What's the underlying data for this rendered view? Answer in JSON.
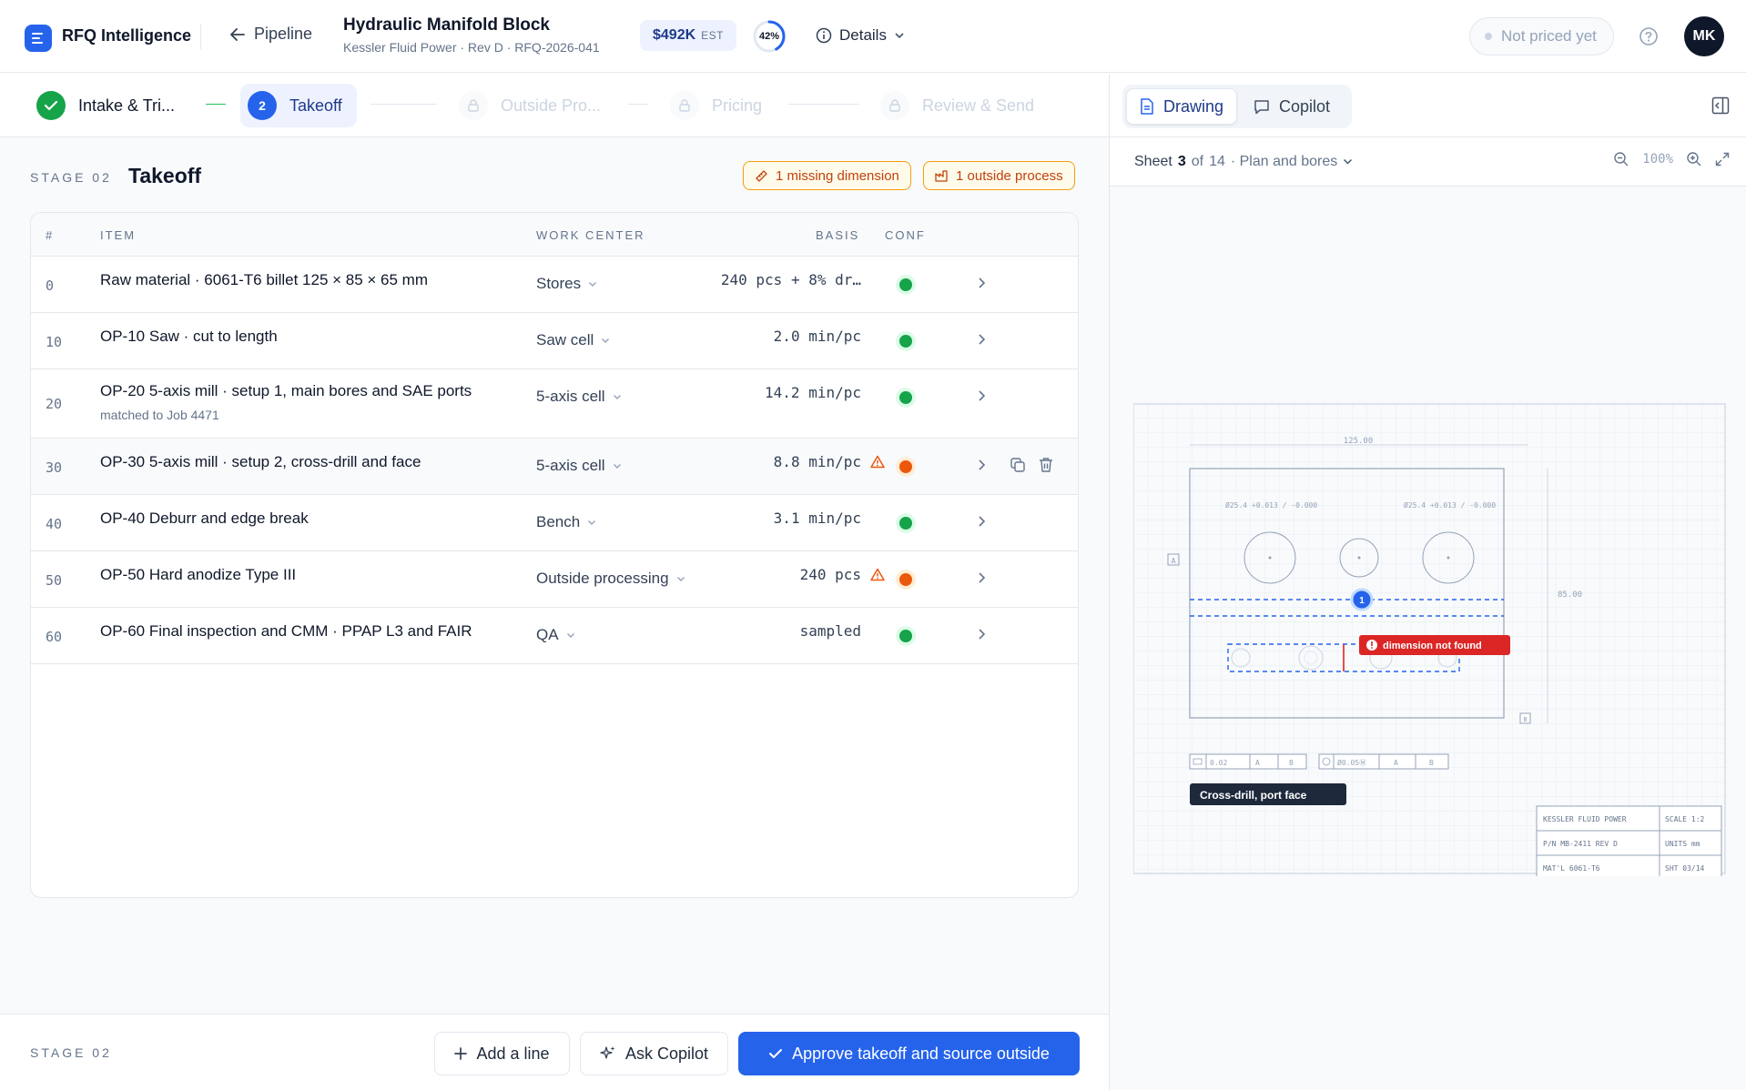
{
  "app": {
    "title": "RFQ Intelligence",
    "back_label": "Pipeline"
  },
  "doc": {
    "title": "Hydraulic Manifold Block",
    "subtitle": "Kessler Fluid Power · Rev D · RFQ-2026-041",
    "estimate": "$492K",
    "estimate_unit": "EST",
    "progress_label": "42%",
    "progress_value": 0.42,
    "details_label": "Details"
  },
  "status": {
    "not_priced": "Not priced yet"
  },
  "user": {
    "initials": "MK"
  },
  "stepper": {
    "steps": [
      {
        "label": "Intake & Tri...",
        "state": "done"
      },
      {
        "label": "Takeoff",
        "number": "2",
        "state": "active"
      },
      {
        "label": "Outside Pro...",
        "state": "locked"
      },
      {
        "label": "Pricing",
        "state": "locked"
      },
      {
        "label": "Review & Send",
        "state": "locked"
      }
    ]
  },
  "stage": {
    "label": "STAGE 02",
    "title": "Takeoff",
    "chips": {
      "missing": "1 missing dimension",
      "outside": "1 outside process"
    }
  },
  "table": {
    "columns": {
      "num": "#",
      "item": "ITEM",
      "work_center": "WORK CENTER",
      "basis": "BASIS",
      "conf": "CONF"
    },
    "rows": [
      {
        "num": "0",
        "item": "Raw material · 6061-T6 billet 125 × 85 × 65 mm",
        "sub": "",
        "work_center": "Stores",
        "basis": "240 pcs + 8% dr…",
        "conf": "green",
        "warn": false
      },
      {
        "num": "10",
        "item": "OP-10 Saw · cut to length",
        "sub": "",
        "work_center": "Saw cell",
        "basis": "2.0 min/pc",
        "conf": "green",
        "warn": false
      },
      {
        "num": "20",
        "item": "OP-20 5-axis mill · setup 1, main bores and SAE ports",
        "sub": "matched to Job 4471",
        "work_center": "5-axis cell",
        "basis": "14.2 min/pc",
        "conf": "green",
        "warn": false
      },
      {
        "num": "30",
        "item": "OP-30 5-axis mill · setup 2, cross-drill and face",
        "sub": "",
        "work_center": "5-axis cell",
        "basis": "8.8 min/pc",
        "conf": "orange",
        "warn": true
      },
      {
        "num": "40",
        "item": "OP-40 Deburr and edge break",
        "sub": "",
        "work_center": "Bench",
        "basis": "3.1 min/pc",
        "conf": "green",
        "warn": false
      },
      {
        "num": "50",
        "item": "OP-50 Hard anodize Type III",
        "sub": "",
        "work_center": "Outside processing",
        "basis": "240 pcs",
        "conf": "orange",
        "warn": true
      },
      {
        "num": "60",
        "item": "OP-60 Final inspection and CMM · PPAP L3 and FAIR",
        "sub": "",
        "work_center": "QA",
        "basis": "sampled",
        "conf": "green",
        "warn": false
      }
    ]
  },
  "footer": {
    "stage_label": "STAGE 02",
    "add_line": "Add a line",
    "ask_copilot": "Ask Copilot",
    "approve": "Approve takeoff and source outside"
  },
  "right_panel": {
    "tabs": {
      "drawing": "Drawing",
      "copilot": "Copilot"
    },
    "sheet": {
      "label": "Sheet",
      "current": "3",
      "of": "of",
      "total": "14",
      "name": "· Plan and bores"
    },
    "zoom": "100%",
    "drawing": {
      "dim_width": "125.00",
      "dim_height": "85.00",
      "bore_left": "Ø25.4 +0.013 / -0.000",
      "bore_right": "Ø25.4 +0.013 / -0.000",
      "datum_a": "A",
      "datum_b": "B",
      "marker": "1",
      "error": "dimension not found",
      "callout": "Cross-drill, port face",
      "fcf1": [
        "0.02",
        "A",
        "B"
      ],
      "fcf2": [
        "Ø0.05Ⓜ",
        "A",
        "B"
      ],
      "title_block": {
        "r1a": "KESSLER FLUID POWER",
        "r1b": "SCALE 1:2",
        "r2a": "P/N MB-2411 REV D",
        "r2b": "UNITS mm",
        "r3a": "MAT'L 6061-T6",
        "r3b": "SHT 03/14"
      }
    }
  },
  "colors": {
    "primary": "#2563eb",
    "success": "#16a34a",
    "warning": "#ea580c",
    "error": "#dc2626"
  }
}
